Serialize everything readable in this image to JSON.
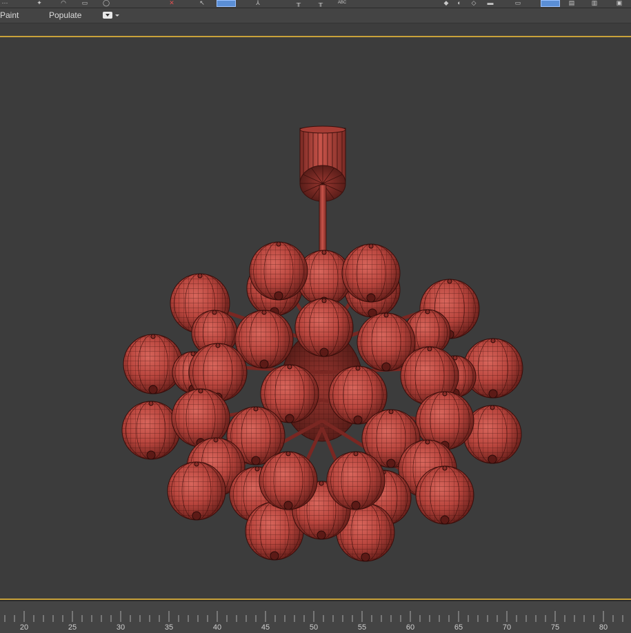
{
  "ribbon": {
    "tabs": [
      "Paint",
      "Populate"
    ],
    "dropdown_icon": "ribbon-options-dropdown-icon"
  },
  "toolbar": {
    "text_icon_label": "ABC",
    "accent_color": "#5b8fd6"
  },
  "viewport": {
    "object_name": "chandelier-wireframe",
    "object_color": "#b8453d",
    "border_color": "#c9a23a",
    "background_color": "#3c3c3c"
  },
  "timeline": {
    "tick_labels": [
      "20",
      "25",
      "30",
      "35",
      "40",
      "45",
      "50",
      "55",
      "60",
      "65",
      "70",
      "75",
      "80"
    ]
  }
}
